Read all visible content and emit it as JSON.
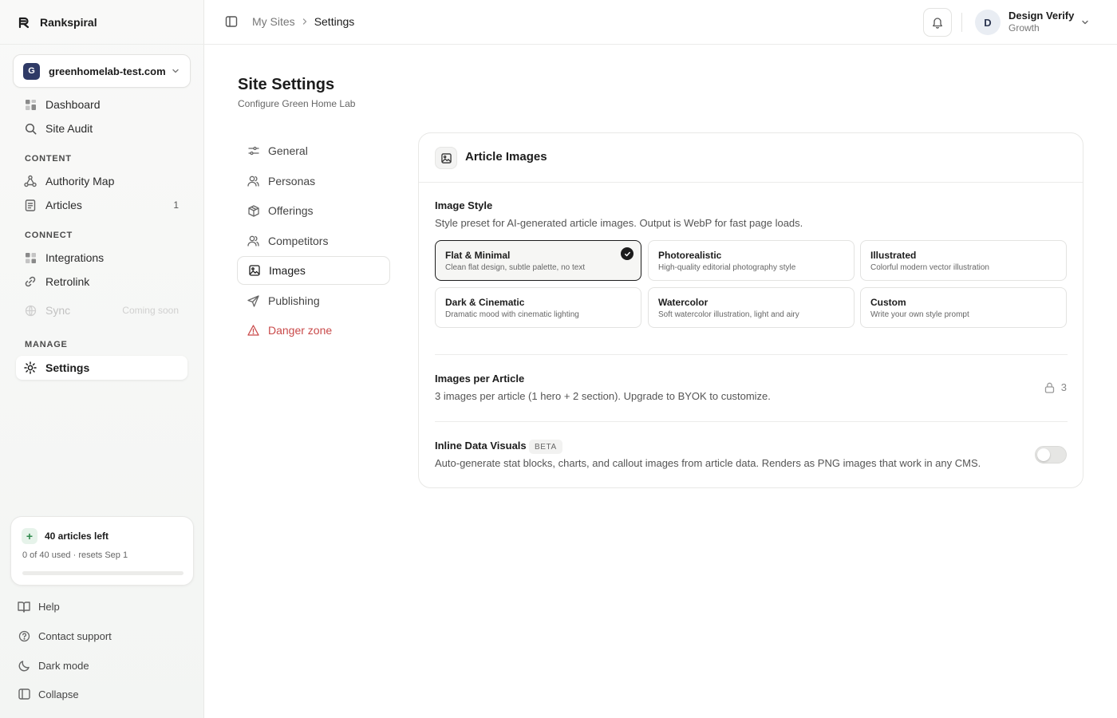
{
  "app": {
    "brand_name": "Rankspiral"
  },
  "site_selector": {
    "avatar_letter": "G",
    "site_name": "greenhomelab-test.com"
  },
  "sidebar": {
    "top_items": [
      {
        "label": "Dashboard",
        "icon": "grid-icon"
      },
      {
        "label": "Site Audit",
        "icon": "search-icon"
      }
    ],
    "sections": {
      "content": "CONTENT",
      "connect": "CONNECT",
      "manage": "MANAGE"
    },
    "content_items": [
      {
        "label": "Authority Map",
        "icon": "network-icon"
      },
      {
        "label": "Articles",
        "icon": "document-icon",
        "count": "1"
      }
    ],
    "connect_items": [
      {
        "label": "Integrations",
        "icon": "grid-icon"
      },
      {
        "label": "Retrolink",
        "icon": "link-icon"
      },
      {
        "label": "Sync",
        "icon": "globe-icon",
        "badge": "Coming soon",
        "disabled": true
      }
    ],
    "manage_items": [
      {
        "label": "Settings",
        "icon": "gear-icon",
        "active": true
      }
    ],
    "usage": {
      "title": "40 articles left",
      "subtitle": "0 of 40 used · resets Sep 1",
      "used_fraction": 0
    },
    "footer_items": [
      {
        "label": "Help",
        "icon": "book-icon"
      },
      {
        "label": "Contact support",
        "icon": "help-circle-icon"
      },
      {
        "label": "Dark mode",
        "icon": "moon-icon"
      },
      {
        "label": "Collapse",
        "icon": "panel-icon"
      }
    ]
  },
  "topbar": {
    "breadcrumb": [
      "My Sites",
      "Settings"
    ],
    "user": {
      "initial": "D",
      "name": "Design Verify",
      "plan": "Growth"
    }
  },
  "page": {
    "title": "Site Settings",
    "subtitle": "Configure Green Home Lab"
  },
  "settings_nav": [
    {
      "label": "General",
      "icon": "sliders-icon"
    },
    {
      "label": "Personas",
      "icon": "users-icon"
    },
    {
      "label": "Offerings",
      "icon": "package-icon"
    },
    {
      "label": "Competitors",
      "icon": "users-icon"
    },
    {
      "label": "Images",
      "icon": "image-icon",
      "active": true
    },
    {
      "label": "Publishing",
      "icon": "send-icon"
    },
    {
      "label": "Danger zone",
      "icon": "warning-icon",
      "danger": true
    }
  ],
  "card": {
    "title": "Article Images",
    "image_style": {
      "title": "Image Style",
      "description": "Style preset for AI-generated article images. Output is WebP for fast page loads.",
      "options": [
        {
          "name": "Flat & Minimal",
          "description": "Clean flat design, subtle palette, no text",
          "selected": true
        },
        {
          "name": "Photorealistic",
          "description": "High-quality editorial photography style"
        },
        {
          "name": "Illustrated",
          "description": "Colorful modern vector illustration"
        },
        {
          "name": "Dark & Cinematic",
          "description": "Dramatic mood with cinematic lighting"
        },
        {
          "name": "Watercolor",
          "description": "Soft watercolor illustration, light and airy"
        },
        {
          "name": "Custom",
          "description": "Write your own style prompt"
        }
      ]
    },
    "images_per_article": {
      "title": "Images per Article",
      "description": "3 images per article (1 hero + 2 section). Upgrade to BYOK to customize.",
      "value": "3"
    },
    "inline_data_visuals": {
      "title": "Inline Data Visuals",
      "badge": "BETA",
      "description": "Auto-generate stat blocks, charts, and callout images from article data. Renders as PNG images that work in any CMS.",
      "enabled": false
    }
  },
  "colors": {
    "accent_green": "#2f8a4c",
    "danger": "#c94a4a",
    "selected_border": "#1c1c1c",
    "site_avatar": "#2f3a66"
  }
}
